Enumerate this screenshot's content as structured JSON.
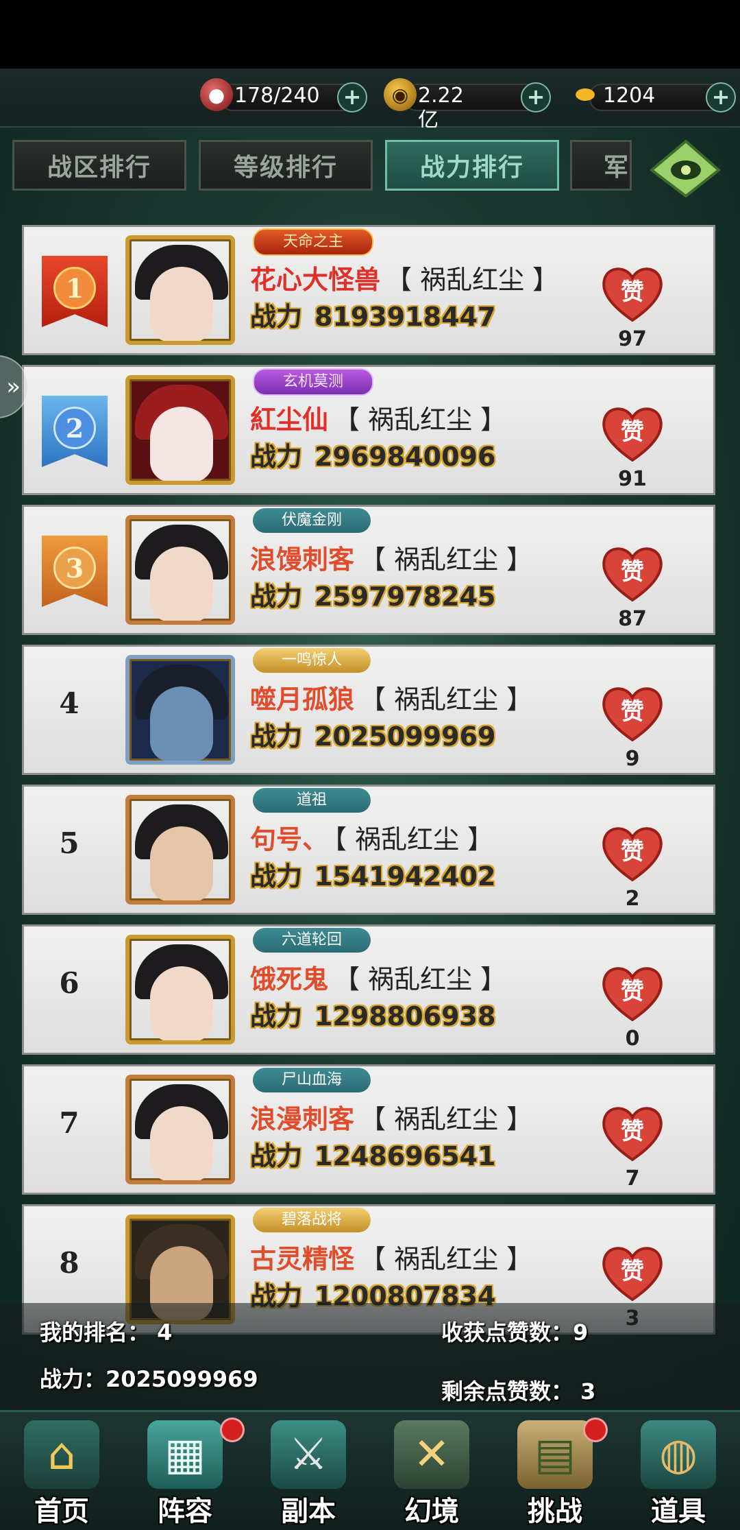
{
  "resources": {
    "stamina": "178/240",
    "coins": "2.22亿",
    "ingots": "1204"
  },
  "tabs": [
    "战区排行",
    "等级排行",
    "战力排行",
    "军"
  ],
  "power_label": "战力",
  "rows": [
    {
      "rank": "1",
      "badge": "天命之主",
      "name": "花心大怪兽",
      "guild": "【 祸乱红尘 】",
      "power": "8193918447",
      "likes": "97"
    },
    {
      "rank": "2",
      "badge": "玄机莫测",
      "name": "紅尘仙",
      "guild": "【 祸乱红尘 】",
      "power": "2969840096",
      "likes": "91"
    },
    {
      "rank": "3",
      "badge": "伏魔金刚",
      "name": "浪馒刺客",
      "guild": "【 祸乱红尘 】",
      "power": "2597978245",
      "likes": "87"
    },
    {
      "rank": "4",
      "badge": "一鸣惊人",
      "name": "噬月孤狼",
      "guild": "【 祸乱红尘 】",
      "power": "2025099969",
      "likes": "9"
    },
    {
      "rank": "5",
      "badge": "道祖",
      "name": "句号、",
      "guild": "【 祸乱红尘 】",
      "power": "1541942402",
      "likes": "2"
    },
    {
      "rank": "6",
      "badge": "六道轮回",
      "name": "饿死鬼",
      "guild": "【 祸乱红尘 】",
      "power": "1298806938",
      "likes": "0"
    },
    {
      "rank": "7",
      "badge": "尸山血海",
      "name": "浪漫刺客",
      "guild": "【 祸乱红尘 】",
      "power": "1248696541",
      "likes": "7"
    },
    {
      "rank": "8",
      "badge": "碧落战将",
      "name": "古灵精怪",
      "guild": "【 祸乱红尘 】",
      "power": "1200807834",
      "likes": "3"
    }
  ],
  "summary": {
    "my_rank_label": "我的排名：",
    "my_rank": "4",
    "my_power_label": "战力：",
    "my_power": "2025099969",
    "received_label": "收获点赞数：",
    "received": "9",
    "remaining_label": "剩余点赞数：",
    "remaining": "3"
  },
  "nav": [
    "首页",
    "阵容",
    "副本",
    "幻境",
    "挑战",
    "道具"
  ],
  "like_label": "赞",
  "colors": {
    "accent": "#6fbfa8",
    "like": "#d8443a",
    "name_red": "#e0302a",
    "power_outline": "#d9a62a"
  }
}
